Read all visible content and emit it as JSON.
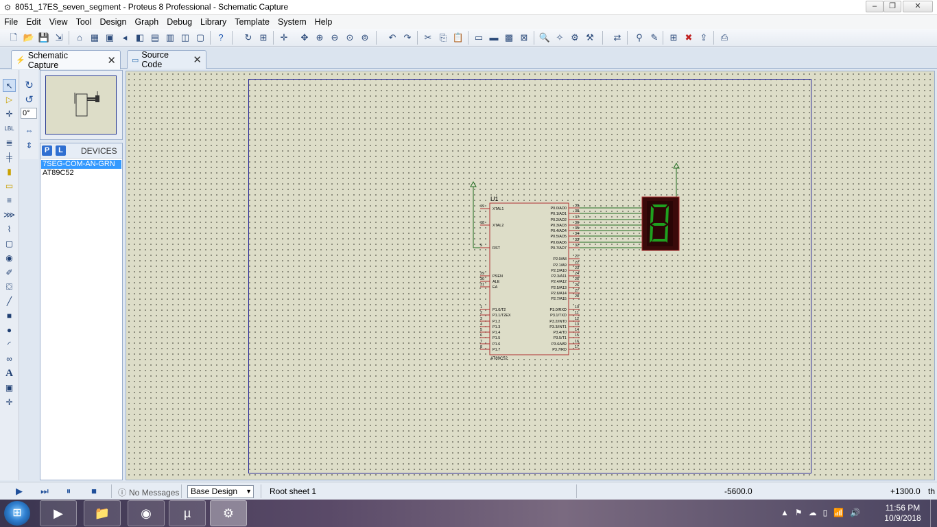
{
  "window": {
    "title": "8051_17ES_seven_segment - Proteus 8 Professional - Schematic Capture",
    "controls": {
      "minimize": "–",
      "maximize": "❐",
      "close": "✕"
    }
  },
  "menu": [
    "File",
    "Edit",
    "View",
    "Tool",
    "Design",
    "Graph",
    "Debug",
    "Library",
    "Template",
    "System",
    "Help"
  ],
  "tabs": [
    {
      "label": "Schematic Capture",
      "active": true
    },
    {
      "label": "Source Code",
      "active": false
    }
  ],
  "rotation": "0°",
  "devices": {
    "p_label": "P",
    "l_label": "L",
    "title": "DEVICES",
    "items": [
      {
        "label": "7SEG-COM-AN-GRN",
        "selected": true
      },
      {
        "label": "AT89C52",
        "selected": false
      }
    ]
  },
  "schematic": {
    "refdes": "U1",
    "part": "AT89C52",
    "left_pins": [
      {
        "num": "19",
        "name": "XTAL1"
      },
      {
        "num": "18",
        "name": "XTAL2"
      },
      {
        "num": "9",
        "name": "RST"
      },
      {
        "num": "29",
        "name": "PSEN"
      },
      {
        "num": "30",
        "name": "ALE"
      },
      {
        "num": "31",
        "name": "EA"
      },
      {
        "num": "1",
        "name": "P1.0/T2"
      },
      {
        "num": "2",
        "name": "P1.1/T2EX"
      },
      {
        "num": "3",
        "name": "P1.2"
      },
      {
        "num": "4",
        "name": "P1.3"
      },
      {
        "num": "5",
        "name": "P1.4"
      },
      {
        "num": "6",
        "name": "P1.5"
      },
      {
        "num": "7",
        "name": "P1.6"
      },
      {
        "num": "8",
        "name": "P1.7"
      }
    ],
    "right_pins": [
      {
        "num": "39",
        "name": "P0.0/AD0"
      },
      {
        "num": "38",
        "name": "P0.1/AD1"
      },
      {
        "num": "37",
        "name": "P0.2/AD2"
      },
      {
        "num": "36",
        "name": "P0.3/AD3"
      },
      {
        "num": "35",
        "name": "P0.4/AD4"
      },
      {
        "num": "34",
        "name": "P0.5/AD5"
      },
      {
        "num": "33",
        "name": "P0.6/AD6"
      },
      {
        "num": "32",
        "name": "P0.7/AD7"
      },
      {
        "num": "21",
        "name": "P2.0/A8"
      },
      {
        "num": "22",
        "name": "P2.1/A9"
      },
      {
        "num": "23",
        "name": "P2.2/A10"
      },
      {
        "num": "24",
        "name": "P2.3/A11"
      },
      {
        "num": "25",
        "name": "P2.4/A12"
      },
      {
        "num": "26",
        "name": "P2.5/A13"
      },
      {
        "num": "27",
        "name": "P2.6/A14"
      },
      {
        "num": "28",
        "name": "P2.7/A15"
      },
      {
        "num": "10",
        "name": "P3.0/RXD"
      },
      {
        "num": "11",
        "name": "P3.1/TXD"
      },
      {
        "num": "12",
        "name": "P3.2/INT0"
      },
      {
        "num": "13",
        "name": "P3.3/INT1"
      },
      {
        "num": "14",
        "name": "P3.4/T0"
      },
      {
        "num": "15",
        "name": "P3.5/T1"
      },
      {
        "num": "16",
        "name": "P3.6/WR"
      },
      {
        "num": "17",
        "name": "P3.7/RD"
      }
    ],
    "display_digit": "8"
  },
  "status": {
    "messages": "No Messages",
    "layer": "Base Design",
    "sheet": "Root sheet 1",
    "x": "-5600.0",
    "y": "+1300.0",
    "unit": "th"
  },
  "clock": {
    "time": "11:56 PM",
    "date": "10/9/2018"
  },
  "colors": {
    "canvas": "#ddddc8",
    "sheet_border": "#2a2a9a",
    "component_outline": "#b03030",
    "wire": "#1e6b1e",
    "segment_lit": "#1fa01f",
    "display_body": "#3a0a0a"
  }
}
